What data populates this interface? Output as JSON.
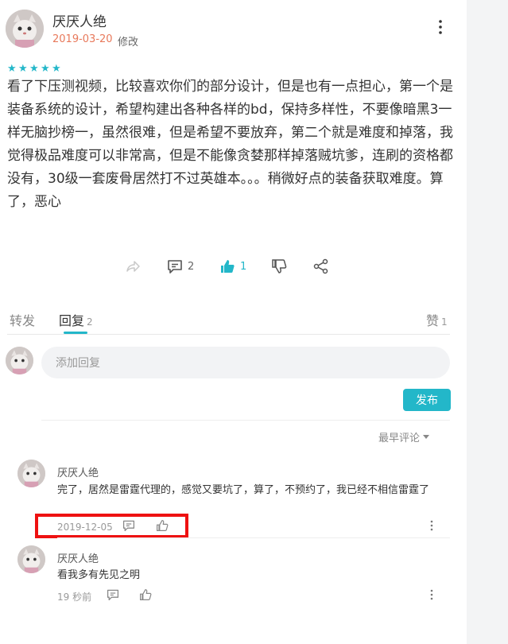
{
  "post": {
    "author": "厌厌人绝",
    "date": "2019-03-20",
    "edit_label": "修改",
    "rating_stars": 5,
    "text": "看了下压测视频，比较喜欢你们的部分设计，但是也有一点担心，第一个是装备系统的设计，希望构建出各种各样的bd，保持多样性，不要像暗黑3一样无脑抄榜一，虽然很难，但是希望不要放弃，第二个就是难度和掉落，我觉得极品难度可以非常高，但是不能像贪婪那样掉落贼坑爹，连刷的资格都没有，30级一套废骨居然打不过英雄本。。。稍微好点的装备获取难度。算了，恶心",
    "comment_count": "2",
    "like_count": "1"
  },
  "tabs": [
    {
      "label": "转发",
      "count": ""
    },
    {
      "label": "回复",
      "count": "2"
    },
    {
      "label": "赞",
      "count": "1"
    }
  ],
  "reply_input": {
    "placeholder": "添加回复",
    "value": ""
  },
  "publish_label": "发布",
  "sort_label": "最早评论",
  "comments": [
    {
      "author": "厌厌人绝",
      "text": "完了，居然是雷霆代理的，感觉又要坑了，算了，不预约了，我已经不相信雷霆了",
      "time": "2019-12-05"
    },
    {
      "author": "厌厌人绝",
      "text": "看我多有先见之明",
      "time": "19 秒前"
    }
  ],
  "colors": {
    "accent": "#23b7c9",
    "date": "#e8795b",
    "highlight": "#ee1111"
  },
  "icons": [
    "share-icon",
    "comment-icon",
    "thumbs-up-icon",
    "thumbs-down-icon",
    "network-share-icon",
    "more-vertical-icon",
    "star-icon",
    "caret-down-icon"
  ]
}
